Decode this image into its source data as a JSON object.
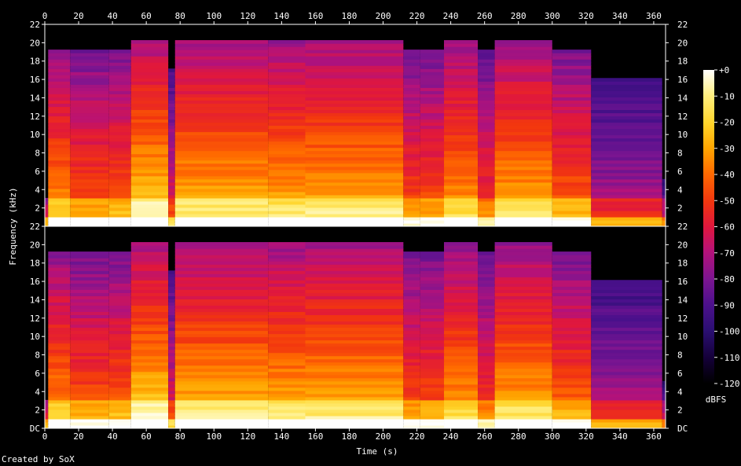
{
  "chart_data": {
    "type": "heatmap",
    "subtype": "spectrogram",
    "channels": 2,
    "xlabel": "Time (s)",
    "ylabel": "Frequency (kHz)",
    "xlim": [
      0,
      367
    ],
    "x_ticks": [
      "0",
      "20",
      "40",
      "60",
      "80",
      "100",
      "120",
      "140",
      "160",
      "180",
      "200",
      "220",
      "240",
      "260",
      "280",
      "300",
      "320",
      "340",
      "360"
    ],
    "ylim_khz": [
      0,
      22
    ],
    "y_ticks": [
      "DC",
      "2",
      "4",
      "6",
      "8",
      "10",
      "12",
      "14",
      "16",
      "18",
      "20",
      "22"
    ],
    "colorbar": {
      "label": "dBFS",
      "range": [
        -120,
        0
      ],
      "ticks": [
        "+0",
        "-10",
        "-20",
        "-30",
        "-40",
        "-50",
        "-60",
        "-70",
        "-80",
        "-90",
        "-100",
        "-110",
        "-120"
      ]
    },
    "colors": {
      "background": "#000000",
      "text": "#ffffff",
      "colormap": [
        "#000000",
        "#140038",
        "#2b0f73",
        "#4b108c",
        "#7a1591",
        "#b4127a",
        "#e0173d",
        "#f2360f",
        "#ff6a00",
        "#ffa500",
        "#ffd42a",
        "#ffef80",
        "#ffffff"
      ]
    },
    "segments": [
      {
        "start": 0,
        "end": 2,
        "top_khz": 3,
        "level": 0.45
      },
      {
        "start": 2,
        "end": 15,
        "top_khz": 19,
        "level": 0.72
      },
      {
        "start": 15,
        "end": 38,
        "top_khz": 19,
        "level": 0.64
      },
      {
        "start": 38,
        "end": 51,
        "top_khz": 19,
        "level": 0.66
      },
      {
        "start": 51,
        "end": 73,
        "top_khz": 20,
        "level": 0.82
      },
      {
        "start": 73,
        "end": 77,
        "top_khz": 17,
        "level": 0.5
      },
      {
        "start": 77,
        "end": 132,
        "top_khz": 20,
        "level": 0.78
      },
      {
        "start": 132,
        "end": 154,
        "top_khz": 20,
        "level": 0.77
      },
      {
        "start": 154,
        "end": 212,
        "top_khz": 20,
        "level": 0.78
      },
      {
        "start": 212,
        "end": 222,
        "top_khz": 19,
        "level": 0.62
      },
      {
        "start": 222,
        "end": 236,
        "top_khz": 19,
        "level": 0.63
      },
      {
        "start": 236,
        "end": 256,
        "top_khz": 20,
        "level": 0.74
      },
      {
        "start": 256,
        "end": 266,
        "top_khz": 19,
        "level": 0.58
      },
      {
        "start": 266,
        "end": 300,
        "top_khz": 20,
        "level": 0.76
      },
      {
        "start": 300,
        "end": 323,
        "top_khz": 19,
        "level": 0.66
      },
      {
        "start": 323,
        "end": 365,
        "top_khz": 16,
        "level": 0.42
      },
      {
        "start": 365,
        "end": 367,
        "top_khz": 5,
        "level": 0.35
      }
    ]
  },
  "footer": {
    "credit": "Created by SoX"
  }
}
